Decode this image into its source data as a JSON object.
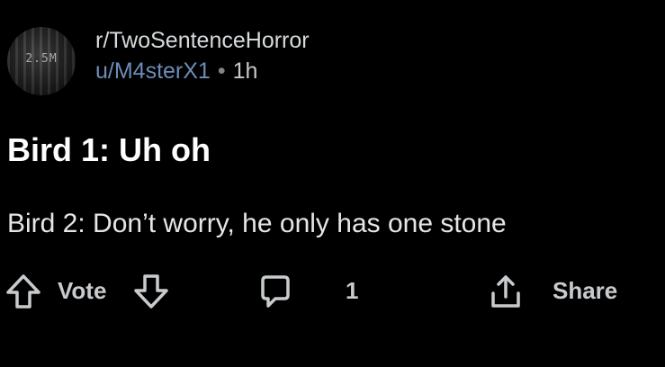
{
  "post": {
    "avatar_text": "2.5M",
    "subreddit": "r/TwoSentenceHorror",
    "username": "u/M4sterX1",
    "separator": "•",
    "age": "1h",
    "title": "Bird 1: Uh oh",
    "body": "Bird 2: Don’t worry, he only has one stone"
  },
  "actions": {
    "vote_label": "Vote",
    "comment_count": "1",
    "share_label": "Share"
  },
  "icons": {
    "upvote": "arrow-up-outline-icon",
    "downvote": "arrow-down-outline-icon",
    "comment": "speech-bubble-icon",
    "share": "share-upload-icon"
  },
  "colors": {
    "background": "#000000",
    "username": "#6b8db6",
    "muted": "#818384",
    "text": "#ffffff"
  }
}
